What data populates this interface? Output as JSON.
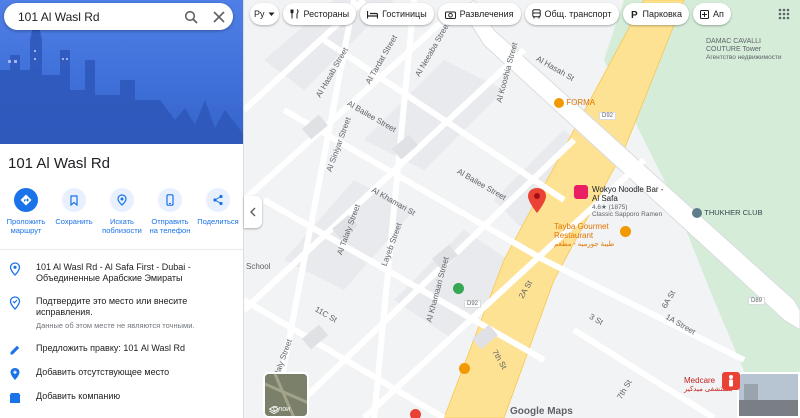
{
  "search": {
    "query": "101 Al Wasl Rd"
  },
  "place": {
    "title": "101 Al Wasl Rd",
    "actions": [
      {
        "label": "Проложить\nмаршрут"
      },
      {
        "label": "Сохранить"
      },
      {
        "label": "Искать\nпоблизости"
      },
      {
        "label": "Отправить\nна телефон"
      },
      {
        "label": "Поделиться"
      }
    ],
    "address": "101 Al Wasl Rd - Al Safa First - Dubai - Объединенные Арабские Эмираты",
    "confirm": "Подтвердите это место или внесите исправления.",
    "confirm_sub": "Данные об этом месте не являются точными.",
    "suggest_edit": "Предложить правку: 101 Al Wasl Rd",
    "add_place": "Добавить отсутствующее место",
    "add_business": "Добавить компанию"
  },
  "map": {
    "chips": [
      "Ру",
      "Рестораны",
      "Гостиницы",
      "Развлечения",
      "Общ. транспорт",
      "Парковка",
      "Ап"
    ],
    "layers_label": "Слои",
    "logo": "Google Maps",
    "streets": [
      "Al Hasab Street",
      "Al Tardat Street",
      "Al Neeaba Street",
      "Al Kooshia Street",
      "Al Hasah St",
      "Al Bailee Street",
      "Al Siniyar Street",
      "Al Bailee Street",
      "Al Khamari St",
      "Al Talaly Street",
      "Layeb Street",
      "Al Khamaari Street",
      "2A St",
      "3 St",
      "1A Street",
      "11C St",
      "7th St",
      "6A St",
      "Al Talaly Street",
      "7th St"
    ],
    "pois": {
      "forma": "FORMA",
      "wokyo_name": "Wokyo Noodle Bar - Al Safa",
      "wokyo_rating": "4.6★ (1875)",
      "wokyo_sub": "Classic Sapporo Ramen",
      "tayba": "Tayba Gourmet Restaurant",
      "tayba_ar": "طيبة جورميه - مطعم",
      "damac": "DAMAC CAVALLI COUTURE Tower",
      "damac_sub": "Агентство недвижимости",
      "thukher": "THUKHER CLUB",
      "medcare": "Medcare",
      "medcare_ar": "مستشفى ميدكير",
      "school": "School"
    },
    "road_badges": [
      "D92",
      "D92",
      "D89"
    ]
  }
}
